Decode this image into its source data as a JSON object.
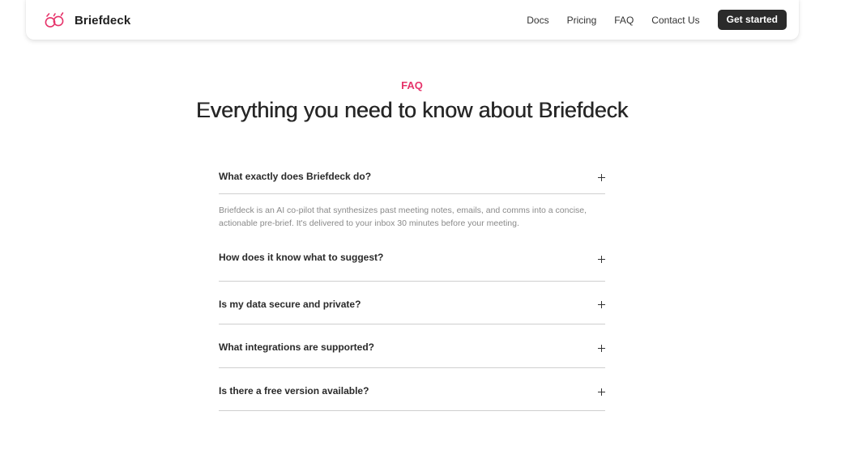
{
  "brand": {
    "name": "Briefdeck",
    "logo_icon": "two-linked-rings-logo",
    "accent_color": "#e6336a"
  },
  "nav": {
    "links": [
      "Docs",
      "Pricing",
      "FAQ",
      "Contact Us"
    ],
    "cta_label": "Get started"
  },
  "faq": {
    "eyebrow": "FAQ",
    "title": "Everything you need to know about Briefdeck",
    "items": [
      {
        "question": "What exactly does Briefdeck do?",
        "answer": "Briefdeck is an AI co-pilot that synthesizes past meeting notes, emails, and comms into a concise, actionable pre-brief. It's delivered to your inbox 30 minutes before your meeting.",
        "expanded": true
      },
      {
        "question": "How does it know what to suggest?",
        "expanded": false
      },
      {
        "question": "Is my data secure and private?",
        "expanded": false
      },
      {
        "question": "What integrations are supported?",
        "expanded": false
      },
      {
        "question": "Is there a free version available?",
        "expanded": false
      }
    ],
    "toggle_icon": "plus-icon"
  }
}
